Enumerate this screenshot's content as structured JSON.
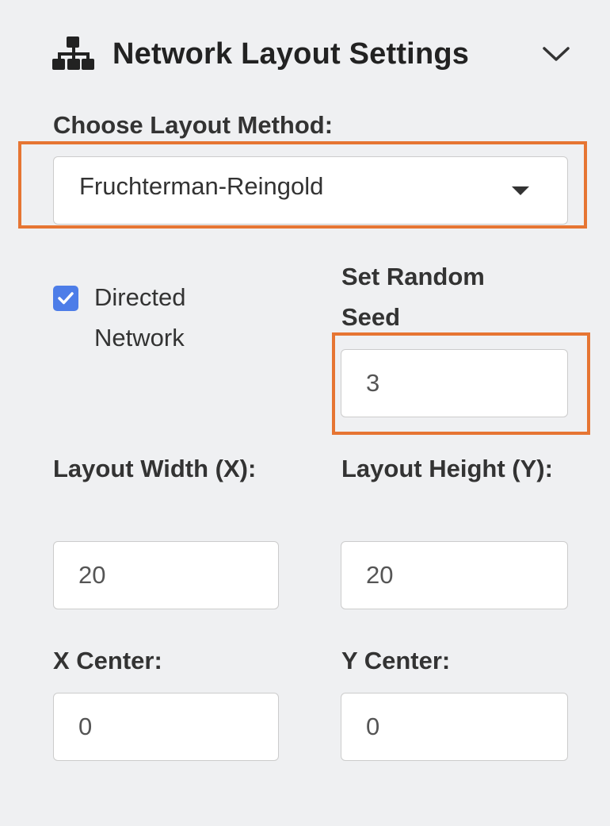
{
  "header": {
    "title": "Network Layout Settings",
    "icon": "sitemap-icon",
    "toggle_icon": "chevron-down-icon"
  },
  "layout_method": {
    "label": "Choose Layout Method:",
    "selected": "Fruchterman-Reingold",
    "highlight_color": "#e67533"
  },
  "directed": {
    "label": "Directed Network",
    "checked": true,
    "accent_color": "#4d7de8"
  },
  "random_seed": {
    "label": "Set Random Seed",
    "value": "3",
    "highlight_color": "#e67533"
  },
  "width": {
    "label": "Layout Width (X):",
    "value": "20"
  },
  "height": {
    "label": "Layout Height (Y):",
    "value": "20"
  },
  "x_center": {
    "label": "X Center:",
    "value": "0"
  },
  "y_center": {
    "label": "Y Center:",
    "value": "0"
  }
}
